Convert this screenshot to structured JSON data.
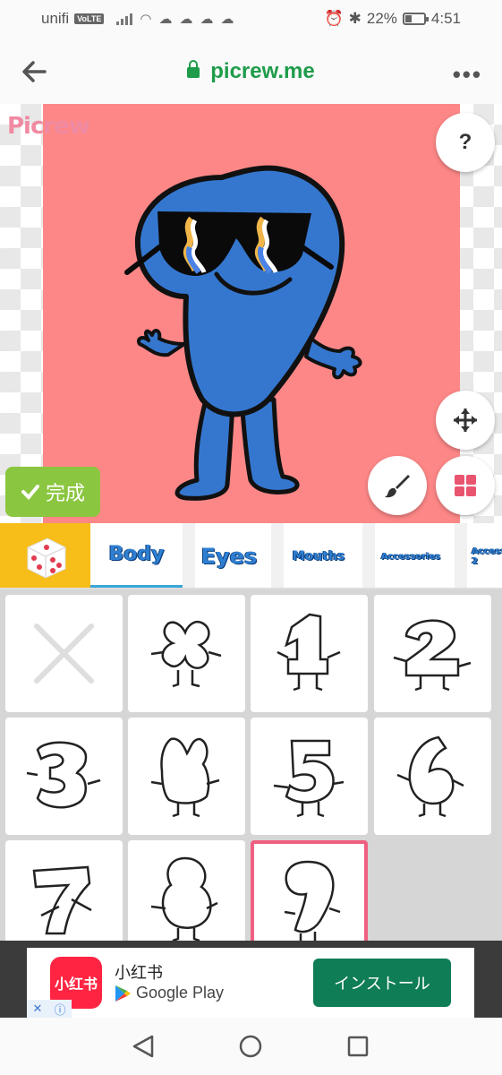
{
  "status_bar": {
    "carrier": "unifi",
    "volte": "VoLTE",
    "battery": "22%",
    "time": "4:51"
  },
  "browser": {
    "url": "picrew.me"
  },
  "canvas": {
    "logo": "Picrew",
    "help": "?",
    "done_label": "完成",
    "art_background": "#fd8787",
    "character_color": "#3577cf"
  },
  "tabs": [
    {
      "label": "Body",
      "selected": true
    },
    {
      "label": "Eyes"
    },
    {
      "label": "Mouths"
    },
    {
      "label": "Accessories"
    },
    {
      "label": "Access... 2"
    }
  ],
  "body_options": [
    {
      "name": "none"
    },
    {
      "name": "four"
    },
    {
      "name": "one"
    },
    {
      "name": "two"
    },
    {
      "name": "three"
    },
    {
      "name": "four-alt"
    },
    {
      "name": "five"
    },
    {
      "name": "six"
    },
    {
      "name": "seven"
    },
    {
      "name": "eight"
    },
    {
      "name": "nine",
      "selected": true
    }
  ],
  "ad": {
    "app_name": "小红书",
    "app_icon_text": "小红书",
    "store": "Google Play",
    "install_label": "インストール"
  },
  "colors": {
    "url_green": "#1e9c4a",
    "done_green": "#8ac63f",
    "dice_tab": "#f7bd18",
    "selected_border": "#ef5f80",
    "install_button": "#0f7d55"
  }
}
